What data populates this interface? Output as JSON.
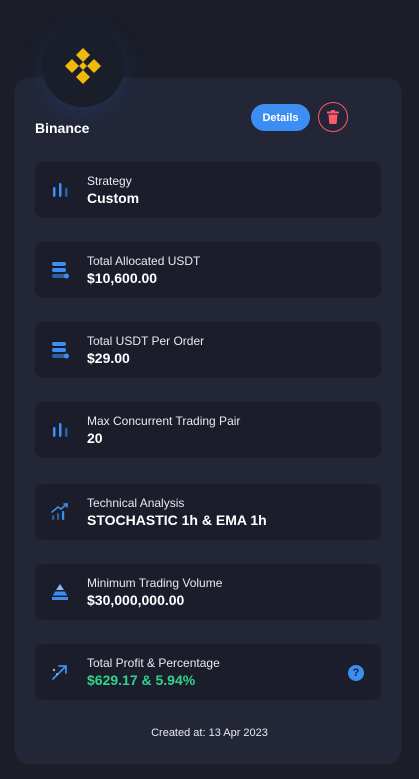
{
  "exchange": {
    "name": "Binance",
    "logo_icon": "binance-logo-icon",
    "brand_color": "#f0b90b"
  },
  "actions": {
    "details_label": "Details",
    "delete_icon": "trash-icon"
  },
  "rows": [
    {
      "label": "Strategy",
      "value": "Custom",
      "icon": "bar-chart-icon"
    },
    {
      "label": "Total Allocated USDT",
      "value": "$10,600.00",
      "icon": "stack-icon"
    },
    {
      "label": "Total USDT Per Order",
      "value": "$29.00",
      "icon": "stack-icon"
    },
    {
      "label": "Max Concurrent Trading Pair",
      "value": "20",
      "icon": "bar-chart-icon"
    },
    {
      "label": "Technical Analysis",
      "value": "STOCHASTIC 1h & EMA 1h",
      "icon": "trend-up-icon"
    },
    {
      "label": "Minimum Trading Volume",
      "value": "$30,000,000.00",
      "icon": "pyramid-icon"
    },
    {
      "label": "Total Profit & Percentage",
      "value": "$629.17 & 5.94%",
      "icon": "arrow-up-right-icon",
      "help": "?"
    }
  ],
  "footer": {
    "created_label": "Created at: 13 Apr 2023"
  },
  "colors": {
    "accent": "#3d8ef2",
    "danger": "#ff5a6a",
    "profit": "#2fd48a"
  }
}
